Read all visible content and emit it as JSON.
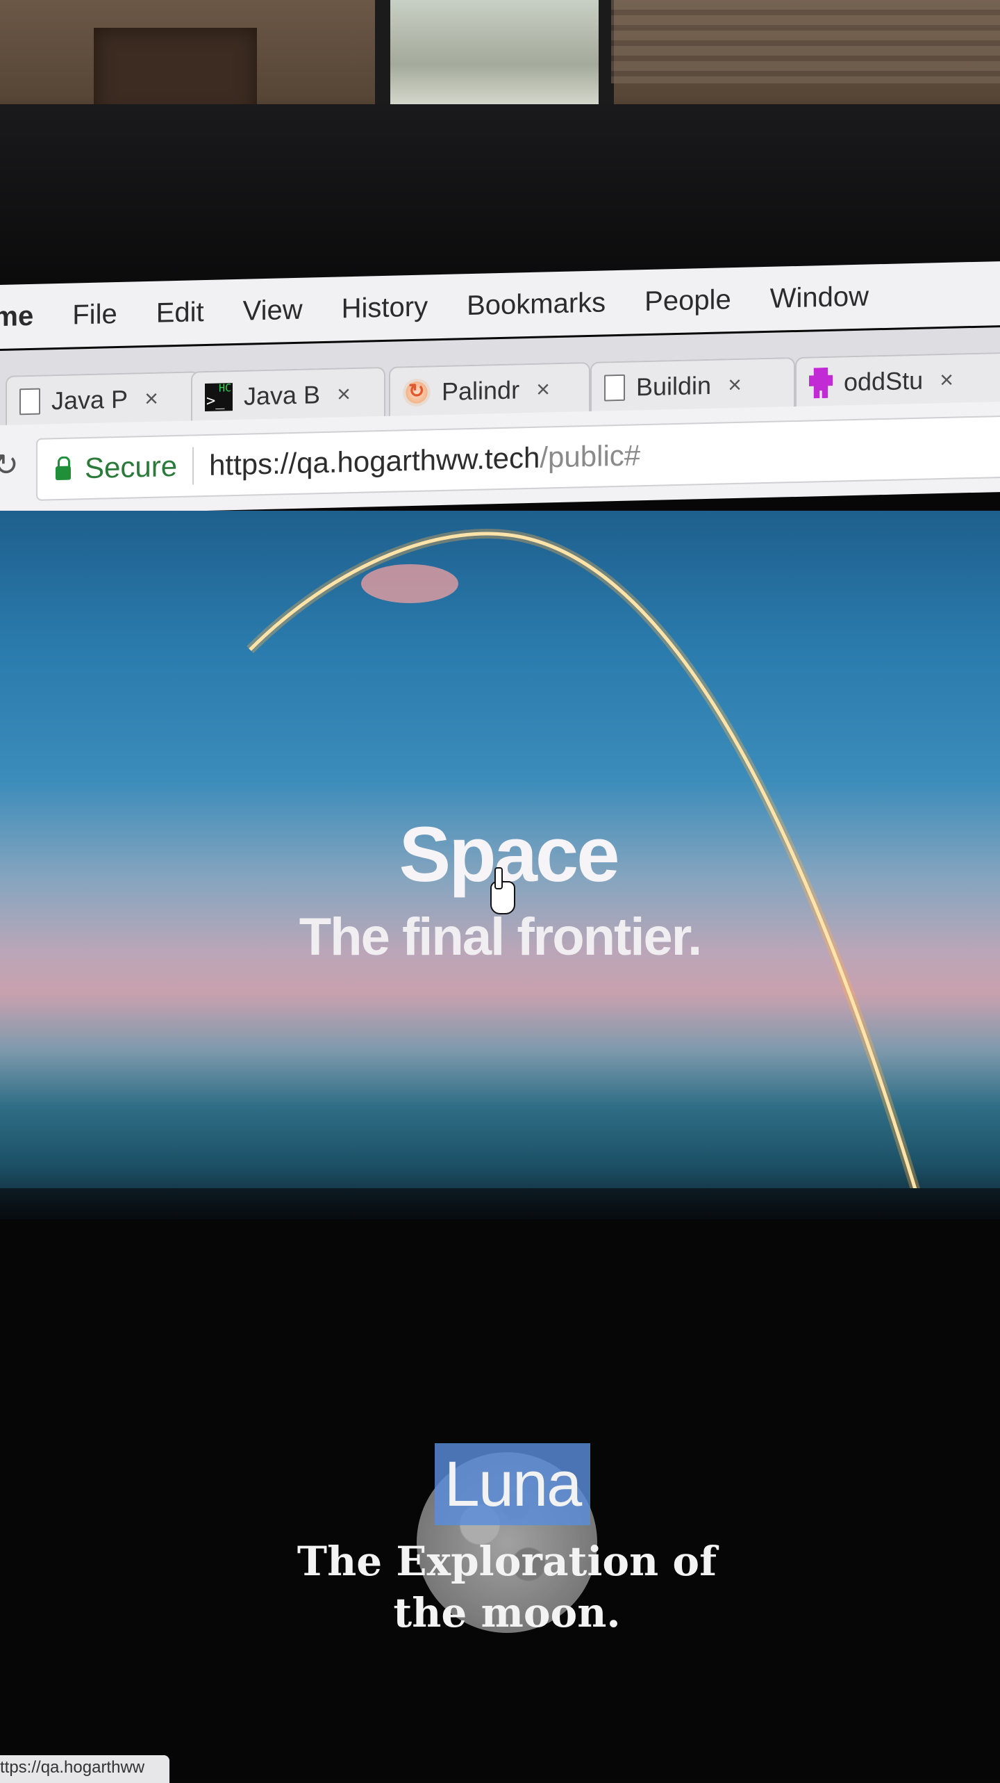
{
  "menubar": {
    "app_name": "ome",
    "items": [
      "File",
      "Edit",
      "View",
      "History",
      "Bookmarks",
      "People",
      "Window"
    ]
  },
  "tabs": [
    {
      "label": "Java P",
      "icon": "document-icon"
    },
    {
      "label": "Java B",
      "icon": "terminal-icon"
    },
    {
      "label": "Palindr",
      "icon": "palindrome-icon"
    },
    {
      "label": "Buildin",
      "icon": "document-icon"
    },
    {
      "label": "oddStu",
      "icon": "odd-stuff-icon"
    }
  ],
  "tab_close_glyph": "×",
  "address_bar": {
    "security_label": "Secure",
    "url_host": "https://qa.hogarthww.tech",
    "url_path": "/public#"
  },
  "hero": {
    "title": "Space",
    "subtitle": "The final frontier."
  },
  "luna": {
    "title": "Luna",
    "subtitle": "The Exploration of the moon."
  },
  "status_bar": {
    "url": "ttps://qa.hogarthww"
  },
  "colors": {
    "secure_green": "#1f8f3a",
    "luna_highlight": "#5a8cdc",
    "rocket_trail": "#ffb347"
  }
}
